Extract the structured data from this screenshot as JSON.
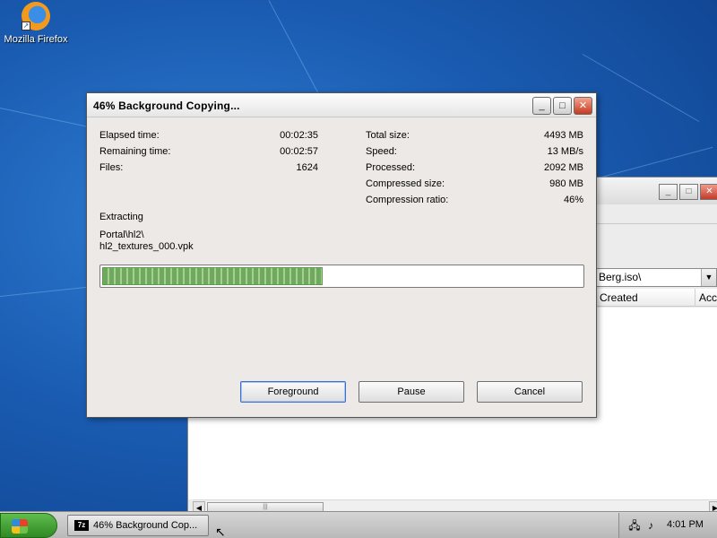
{
  "desktop": {
    "icon_label": "Mozilla Firefox"
  },
  "background_window": {
    "path": "Berg.iso\\",
    "columns": [
      "Created",
      "Acc"
    ]
  },
  "dialog": {
    "title": "46% Background Copying...",
    "left_stats": {
      "elapsed_label": "Elapsed time:",
      "elapsed_value": "00:02:35",
      "remaining_label": "Remaining time:",
      "remaining_value": "00:02:57",
      "files_label": "Files:",
      "files_value": "1624"
    },
    "right_stats": {
      "total_label": "Total size:",
      "total_value": "4493 MB",
      "speed_label": "Speed:",
      "speed_value": "13 MB/s",
      "processed_label": "Processed:",
      "processed_value": "2092 MB",
      "compressed_label": "Compressed size:",
      "compressed_value": "980 MB",
      "ratio_label": "Compression ratio:",
      "ratio_value": "46%"
    },
    "operation": "Extracting",
    "current_dir": "Portal\\hl2\\",
    "current_file": "hl2_textures_000.vpk",
    "progress_fraction": 0.46,
    "buttons": {
      "foreground": "Foreground",
      "pause": "Pause",
      "cancel": "Cancel"
    }
  },
  "taskbar": {
    "task_label": "46% Background Cop...",
    "task_icon": "7z",
    "clock": "4:01 PM"
  }
}
